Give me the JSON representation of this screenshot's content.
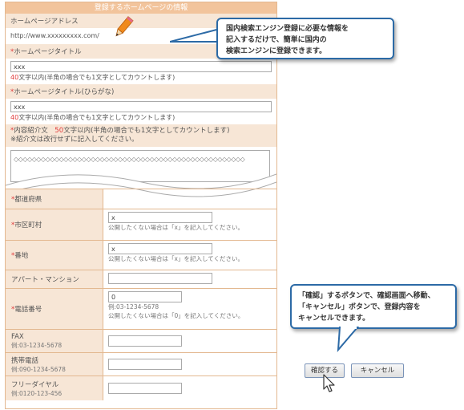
{
  "form": {
    "title": "登録するホームページの情報",
    "url_label": "ホームページアドレス",
    "url_value": "http://www.xxxxxxxxx.com/",
    "title_label": "ホームページタイトル",
    "title_value": "xxx",
    "title_note_num": "40",
    "title_note": "文字以内(半角の場合でも1文字としてカウントします)",
    "kana_label": "ホームページタイトル(ひらがな)",
    "kana_value": "xxx",
    "kana_note_num": "40",
    "kana_note": "文字以内(半角の場合でも1文字としてカウントします)",
    "intro_label": "内容紹介文",
    "intro_num": "50",
    "intro_note": "文字以内(半角の場合でも1文字としてカウントします)",
    "intro_note2": "※紹介文は改行せずに記入してください。",
    "intro_value": "◇◇◇◇◇◇◇◇◇◇◇◇◇◇◇◇◇◇◇◇◇◇◇◇◇◇◇◇◇◇◇◇◇◇◇◇◇◇◇◇◇◇◇◇◇◇◇◇◇◇◇",
    "required_mark": "*",
    "prefecture_label": "都道府県",
    "city_label": "市区町村",
    "city_value": "x",
    "city_note": "公開したくない場合は「x」を記入してください。",
    "address_label": "番地",
    "address_value": "x",
    "address_note": "公開したくない場合は「x」を記入してください。",
    "apartment_label": "アパート・マンション",
    "phone_label": "電話番号",
    "phone_value": "0",
    "phone_example": "例:03-1234-5678",
    "phone_note": "公開したくない場合は「0」を記入してください。",
    "fax_label": "FAX",
    "fax_example": "例:03-1234-5678",
    "mobile_label": "携帯電話",
    "mobile_example": "例:090-1234-5678",
    "freedial_label": "フリーダイヤル",
    "freedial_example": "例:0120-123-456"
  },
  "callout_top": {
    "line1": "国内検索エンジン登録に必要な情報を",
    "line2": "記入するだけで、簡単に国内の",
    "line3": "検索エンジンに登録できます。"
  },
  "callout_bottom": {
    "line1": "「確認」するボタンで、確認画面へ移動、",
    "line2": "「キャンセル」ボタンで、登録内容を",
    "line3": "キャンセルできます。"
  },
  "buttons": {
    "confirm": "確認する",
    "cancel": "キャンセル"
  },
  "colors": {
    "header": "#f2c49c",
    "label_bg": "#f7e6d6",
    "border": "#e3b890",
    "required": "#e03a3a",
    "callout_border": "#2c6aa6"
  },
  "icons": {
    "pencil": "pencil-icon",
    "cursor": "mouse-pointer-icon"
  }
}
